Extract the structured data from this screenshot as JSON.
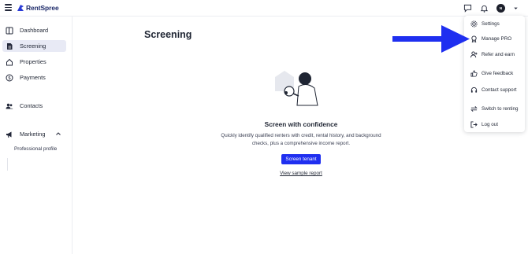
{
  "header": {
    "logo_text": "RentSpree",
    "avatar_initials": "N",
    "icons": [
      "menu-icon",
      "chat-icon",
      "bell-icon",
      "avatar",
      "chevron-down-icon"
    ]
  },
  "sidebar": {
    "items": [
      {
        "label": "Dashboard",
        "icon": "dashboard-icon"
      },
      {
        "label": "Screening",
        "icon": "document-icon",
        "active": true
      },
      {
        "label": "Properties",
        "icon": "home-icon"
      },
      {
        "label": "Payments",
        "icon": "dollar-icon"
      },
      {
        "label": "Contacts",
        "icon": "people-icon"
      },
      {
        "label": "Marketing",
        "icon": "megaphone-icon"
      }
    ],
    "marketing_sub": "Professional profile"
  },
  "main": {
    "title": "Screening",
    "hero_title": "Screen with confidence",
    "hero_desc": "Quickly identify qualified renters with credit, rental history, and background checks, plus a comprehensive income report.",
    "primary_button": "Screen tenant",
    "link": "View sample report"
  },
  "menu": {
    "items": [
      {
        "label": "Settings",
        "icon": "gear-icon"
      },
      {
        "label": "Manage PRO",
        "icon": "pro-badge-icon"
      },
      {
        "label": "Refer and earn",
        "icon": "add-user-icon"
      },
      {
        "label": "Give feedback",
        "icon": "thumbs-up-icon"
      },
      {
        "label": "Contact support",
        "icon": "headset-icon"
      },
      {
        "label": "Switch to renting",
        "icon": "swap-icon"
      },
      {
        "label": "Log out",
        "icon": "logout-icon"
      }
    ]
  },
  "colors": {
    "brand_blue": "#1f2ff0",
    "annotation_arrow": "#1f2ff0",
    "active_bg": "#e8eaf5",
    "text": "#1f2533"
  }
}
